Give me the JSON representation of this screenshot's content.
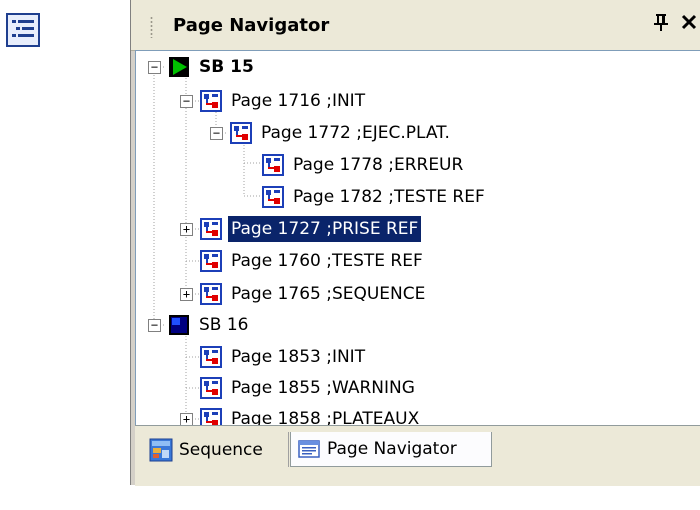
{
  "panel": {
    "title": "Page Navigator",
    "pin_glyph": "ф",
    "close_glyph": "×"
  },
  "tree": {
    "nodes": [
      {
        "label": "SB 15",
        "expander": "−",
        "icon": "sb-active-icon",
        "depth": 0,
        "bold": true,
        "selected": false
      },
      {
        "label": "Page 1716 ;INIT",
        "expander": "−",
        "icon": "page-icon",
        "depth": 1,
        "bold": false,
        "selected": false
      },
      {
        "label": "Page 1772 ;EJEC.PLAT.",
        "expander": "−",
        "icon": "page-icon",
        "depth": 2,
        "bold": false,
        "selected": false
      },
      {
        "label": "Page 1778 ;ERREUR",
        "expander": "",
        "icon": "page-icon",
        "depth": 3,
        "bold": false,
        "selected": false
      },
      {
        "label": "Page 1782 ;TESTE REF",
        "expander": "",
        "icon": "page-icon",
        "depth": 3,
        "bold": false,
        "selected": false
      },
      {
        "label": "Page 1727 ;PRISE REF",
        "expander": "+",
        "icon": "page-icon",
        "depth": 1,
        "bold": false,
        "selected": true
      },
      {
        "label": "Page 1760 ;TESTE REF",
        "expander": "",
        "icon": "page-icon",
        "depth": 1,
        "bold": false,
        "selected": false
      },
      {
        "label": "Page 1765 ;SEQUENCE",
        "expander": "+",
        "icon": "page-icon",
        "depth": 1,
        "bold": false,
        "selected": false
      },
      {
        "label": "SB 16",
        "expander": "−",
        "icon": "sb-inactive-icon",
        "depth": 0,
        "bold": false,
        "selected": false
      },
      {
        "label": "Page 1853 ;INIT",
        "expander": "",
        "icon": "page-icon",
        "depth": 1,
        "bold": false,
        "selected": false
      },
      {
        "label": "Page 1855 ;WARNING",
        "expander": "",
        "icon": "page-icon",
        "depth": 1,
        "bold": false,
        "selected": false
      },
      {
        "label": "Page 1858 ;PLATEAUX",
        "expander": "+",
        "icon": "page-icon",
        "depth": 1,
        "bold": false,
        "selected": false
      }
    ]
  },
  "tabs": [
    {
      "label": "Sequence",
      "icon": "sequence-icon",
      "active": false
    },
    {
      "label": "Page Navigator",
      "icon": "page-navigator-icon",
      "active": true
    }
  ],
  "colors": {
    "selection_bg": "#0a246a",
    "sb_active": "#00a000",
    "sb_inactive": "#000080",
    "page_icon_blue": "#1c3fb8",
    "page_icon_red": "#e00000"
  }
}
